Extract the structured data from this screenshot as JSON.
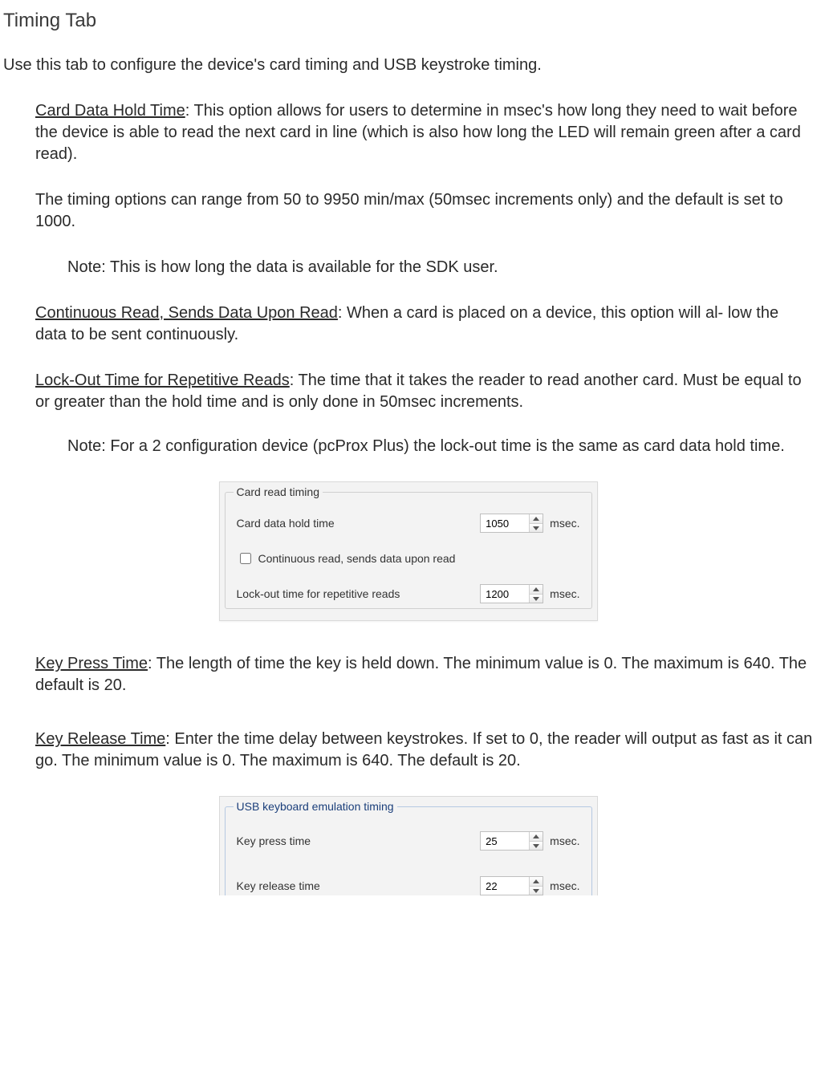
{
  "title": "Timing Tab",
  "intro": "Use this tab to configure the device's card timing and  USB keystroke  timing.",
  "card_hold": {
    "label_u": "Card Data Hold Time",
    "text1": ": This option allows for users to determine in msec's how long they need to wait before the device is able to read the next card in line (which is also how long the LED will remain green after a card read).",
    "text2": "The timing options can range from 50 to 9950 min/max (50msec increments only) and the default is set to 1000.",
    "note": "Note: This is how long the data is available for the SDK user."
  },
  "cont_read": {
    "label_u": "Continuous Read, Sends Data Upon Read",
    "text": ": When a card is placed on a device, this option will al- low the data to be sent continuously."
  },
  "lockout": {
    "label_u": "Lock-Out Time for Repetitive  Reads",
    "text": ": The time that it takes the reader to read another card. Must be equal to or greater than the hold time and is only done in 50msec increments.",
    "note": "Note: For a 2 configuration device (pcProx Plus) the lock-out time is the same as card data hold time."
  },
  "panel1": {
    "legend": "Card read timing",
    "row1_label": "Card data hold time",
    "row1_value": "1050",
    "unit": "msec.",
    "chk_label": "Continuous read, sends data upon read",
    "row2_label": "Lock-out time for repetitive reads",
    "row2_value": "1200"
  },
  "key_press": {
    "label_u": "Key Press Time",
    "text": ": The length of time the key is held down. The minimum value is 0. The maximum is 640. The default is 20."
  },
  "key_release": {
    "label_u": "Key Release Time",
    "text": ": Enter the time delay between keystrokes. If set to 0, the reader will output as fast as it can go. The minimum value is 0. The maximum is 640. The default is 20."
  },
  "panel2": {
    "legend": "USB keyboard emulation timing",
    "row1_label": "Key press time",
    "row1_value": "25",
    "row2_label": "Key release time",
    "row2_value": "22",
    "unit": "msec."
  }
}
